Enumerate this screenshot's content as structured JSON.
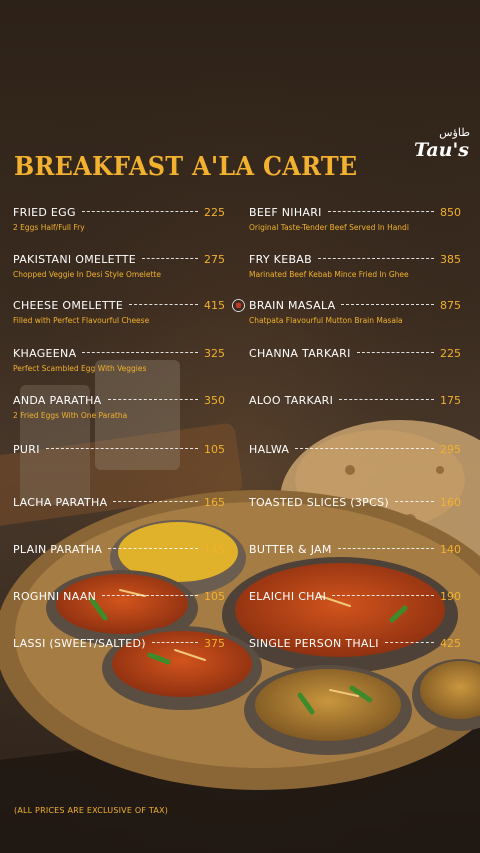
{
  "brand": {
    "name_latin": "Tau's",
    "name_urdu": "طاؤس"
  },
  "title": "BREAKFAST A'LA CARTE",
  "left_items": [
    {
      "name": "FRIED EGG",
      "price": "225",
      "desc": "2 Eggs Half/Full Fry"
    },
    {
      "name": "PAKISTANI OMELETTE",
      "price": "275",
      "desc": "Chopped Veggie In Desi Style Omelette"
    },
    {
      "name": "CHEESE OMELETTE",
      "price": "415",
      "desc": "Filled with Perfect Flavourful Cheese"
    },
    {
      "name": "KHAGEENA",
      "price": "325",
      "desc": "Perfect Scambled Egg With Veggies"
    },
    {
      "name": "ANDA PARATHA",
      "price": "350",
      "desc": "2 Fried Eggs With One Paratha"
    },
    {
      "name": "PURI",
      "price": "105",
      "desc": ""
    },
    {
      "name": "LACHA PARATHA",
      "price": "165",
      "desc": ""
    },
    {
      "name": "PLAIN PARATHA",
      "price": "145",
      "desc": ""
    },
    {
      "name": "ROGHNI NAAN",
      "price": "105",
      "desc": ""
    },
    {
      "name": "LASSI (SWEET/SALTED)",
      "price": "375",
      "desc": ""
    }
  ],
  "right_items": [
    {
      "name": "BEEF NIHARI",
      "price": "850",
      "desc": "Original Taste-Tender Beef Served In Handi"
    },
    {
      "name": "FRY KEBAB",
      "price": "385",
      "desc": "Marinated Beef Kebab Mince Fried In Ghee"
    },
    {
      "name": "BRAIN MASALA",
      "price": "875",
      "desc": "Chatpata Flavourful Mutton Brain Masala"
    },
    {
      "name": "CHANNA TARKARI",
      "price": "225",
      "desc": ""
    },
    {
      "name": "ALOO TARKARI",
      "price": "175",
      "desc": ""
    },
    {
      "name": "HALWA",
      "price": "295",
      "desc": ""
    },
    {
      "name": "TOASTED SLICES (3PCS)",
      "price": "160",
      "desc": ""
    },
    {
      "name": "BUTTER & JAM",
      "price": "140",
      "desc": ""
    },
    {
      "name": "ELAICHI CHAI",
      "price": "190",
      "desc": ""
    },
    {
      "name": "SINGLE PERSON THALI",
      "price": "425",
      "desc": ""
    }
  ],
  "footnote": "(ALL PRICES ARE  EXCLUSIVE OF TAX)",
  "colors": {
    "accent": "#f2b12e",
    "background": "#3a2b1f",
    "text": "#ffffff"
  }
}
